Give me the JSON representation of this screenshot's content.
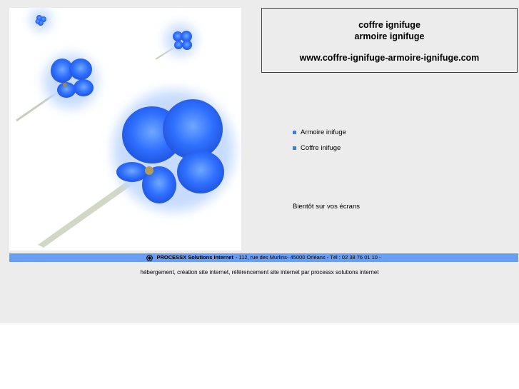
{
  "header": {
    "line1": "coffre ignifuge",
    "line2": "armoire ignifuge",
    "site_url": "www.coffre-ignifuge-armoire-ignifuge.com"
  },
  "nav": {
    "items": [
      {
        "label": "Armoire inifuge"
      },
      {
        "label": "Coffre inifuge"
      }
    ]
  },
  "main": {
    "status_text": "Bientôt sur vos écrans"
  },
  "footer": {
    "company": "PROCESSX Solutions Internet",
    "address": "- 112, rue des Murlins- 45000 Orléans - Tél : 02 38 76 01 10 -",
    "seo_text": "hébergement, création site internet, référencement site internet par processx solutions internet"
  },
  "colors": {
    "accent": "#6a9ef2",
    "bullet": "#3b7de6",
    "flower": "#2f6fff",
    "page_bg": "#ececec"
  },
  "images": {
    "hero": "blue-flowers-illustration"
  }
}
